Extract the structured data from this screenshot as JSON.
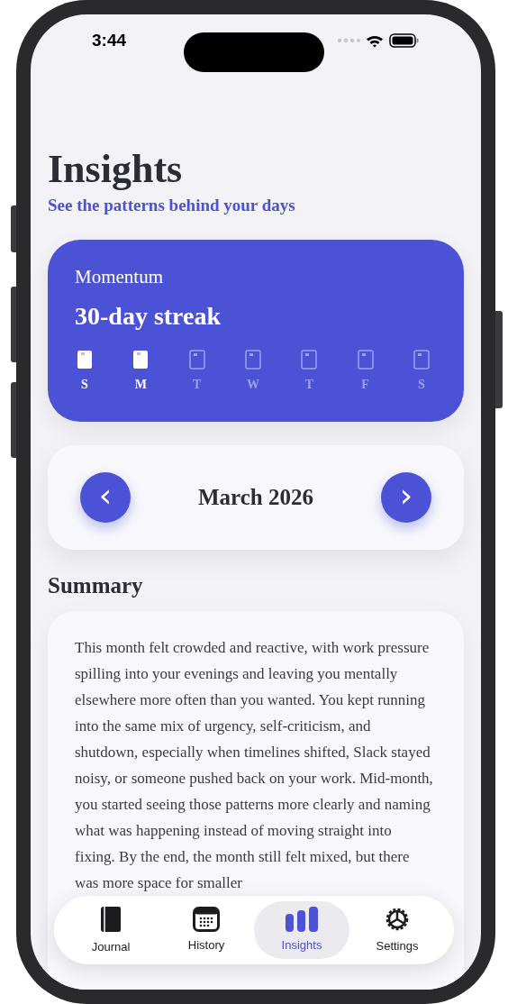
{
  "status_bar": {
    "time": "3:44"
  },
  "header": {
    "title": "Insights",
    "subtitle": "See the patterns behind your days"
  },
  "momentum": {
    "label": "Momentum",
    "streak": "30-day streak",
    "days": [
      {
        "label": "S",
        "done": true
      },
      {
        "label": "M",
        "done": true
      },
      {
        "label": "T",
        "done": false
      },
      {
        "label": "W",
        "done": false
      },
      {
        "label": "T",
        "done": false
      },
      {
        "label": "F",
        "done": false
      },
      {
        "label": "S",
        "done": false
      }
    ]
  },
  "month_picker": {
    "previous": "‹",
    "month": "March 2026",
    "next": "›"
  },
  "summary": {
    "heading": "Summary",
    "text": "This month felt crowded and reactive, with work pressure spilling into your evenings and leaving you mentally elsewhere more often than you wanted. You kept running into the same mix of urgency, self-criticism, and shutdown, especially when timelines shifted, Slack stayed noisy, or someone pushed back on your work. Mid-month, you started seeing those patterns more clearly and naming what was happening instead of moving straight into fixing. By the end, the month still felt mixed, but there was more space for smaller"
  },
  "tab_bar": [
    {
      "label": "Journal",
      "kind": "journal",
      "selected": false
    },
    {
      "label": "History",
      "kind": "history",
      "selected": false
    },
    {
      "label": "Insights",
      "kind": "insights",
      "selected": true
    },
    {
      "label": "Settings",
      "kind": "settings",
      "selected": false
    }
  ]
}
